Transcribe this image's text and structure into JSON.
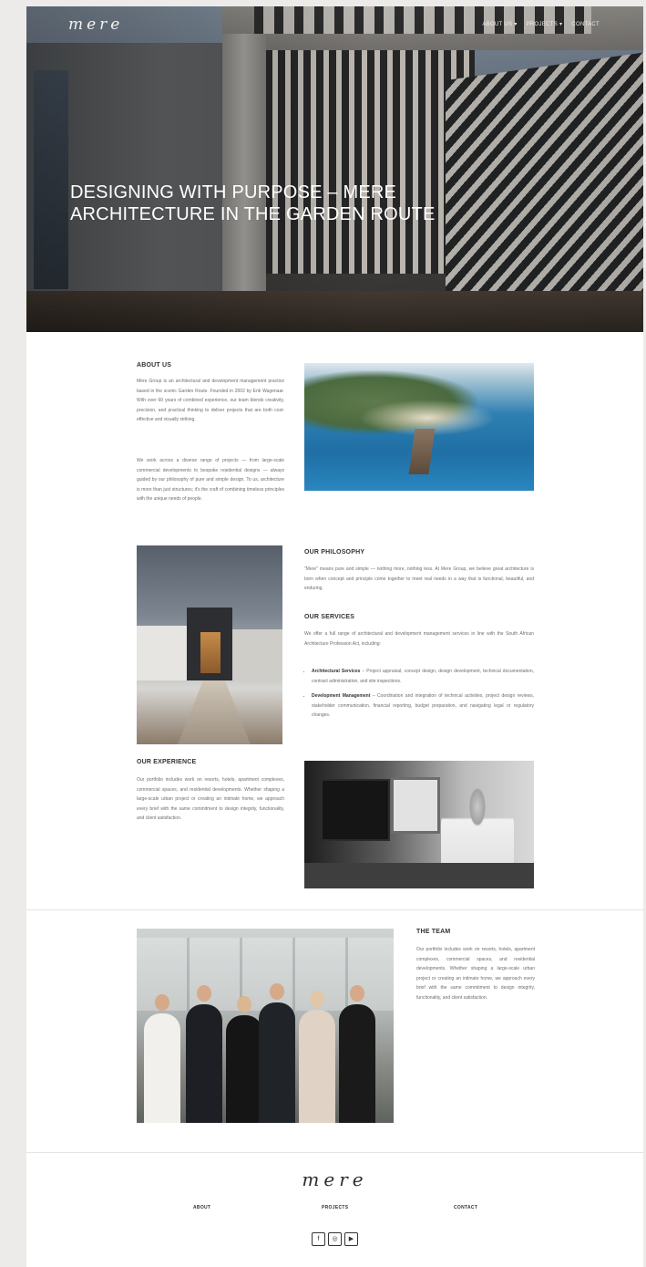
{
  "header": {
    "logo": "mere",
    "nav": [
      "ABOUT US",
      "PROJECTS",
      "CONTACT"
    ],
    "nav_dropdown_marks": [
      "▾",
      "▾"
    ]
  },
  "hero": {
    "title": "DESIGNING WITH PURPOSE – MERE ARCHITECTURE IN THE GARDEN ROUTE"
  },
  "about": {
    "heading": "ABOUT US",
    "p1": "Mere Group is an architectural and development management practice based in the scenic Garden Route. Founded in 2002 by Erik Wagenaar. With over 60 years of combined experience, our team blends creativity, precision, and practical thinking to deliver projects that are both cost-effective and visually striking.",
    "p2": "We work across a diverse range of projects — from large-scale commercial developments to bespoke residential designs — always guided by our philosophy of pure and simple design. To us, architecture is more than just structures; it's the craft of combining timeless principles with the unique needs of people."
  },
  "philosophy": {
    "heading": "OUR PHILOSOPHY",
    "text": "\"Mere\" means pure and simple — nothing more, nothing less. At Mere Group, we believe great architecture is born when concept and principle come together to meet real needs in a way that is functional, beautiful, and enduring."
  },
  "services": {
    "heading": "OUR SERVICES",
    "intro": "We offer a full range of architectural and development management services in line with the South African Architecture Profession Act, including:",
    "items": [
      {
        "title": "Architectural Services",
        "text": " – Project appraisal, concept design, design development, technical documentation, contract administration, and site inspections."
      },
      {
        "title": "Development Management",
        "text": " – Coordination and integration of technical activities, project design reviews, stakeholder communication, financial reporting, budget preparation, and navigating legal or regulatory changes."
      }
    ]
  },
  "experience": {
    "heading": "OUR EXPERIENCE",
    "text": "Our portfolio includes work on resorts, hotels, apartment complexes, commercial spaces, and residential developments. Whether shaping a large-scale urban project or creating an intimate home, we approach every brief with the same commitment to design integrity, functionality, and client satisfaction."
  },
  "team": {
    "heading": "THE TEAM",
    "text": "Our portfolio includes work on resorts, hotels, apartment complexes, commercial spaces, and residential developments. Whether shaping a large-scale urban project or creating an intimate home, we approach every brief with the same commitment to design integrity, functionality, and client satisfaction."
  },
  "footer": {
    "logo": "mere",
    "links": [
      "ABOUT",
      "PROJECTS",
      "CONTACT"
    ],
    "social": [
      {
        "icon": "facebook-icon",
        "glyph": "f"
      },
      {
        "icon": "instagram-icon",
        "glyph": "◎"
      },
      {
        "icon": "youtube-icon",
        "glyph": "▶"
      }
    ]
  }
}
